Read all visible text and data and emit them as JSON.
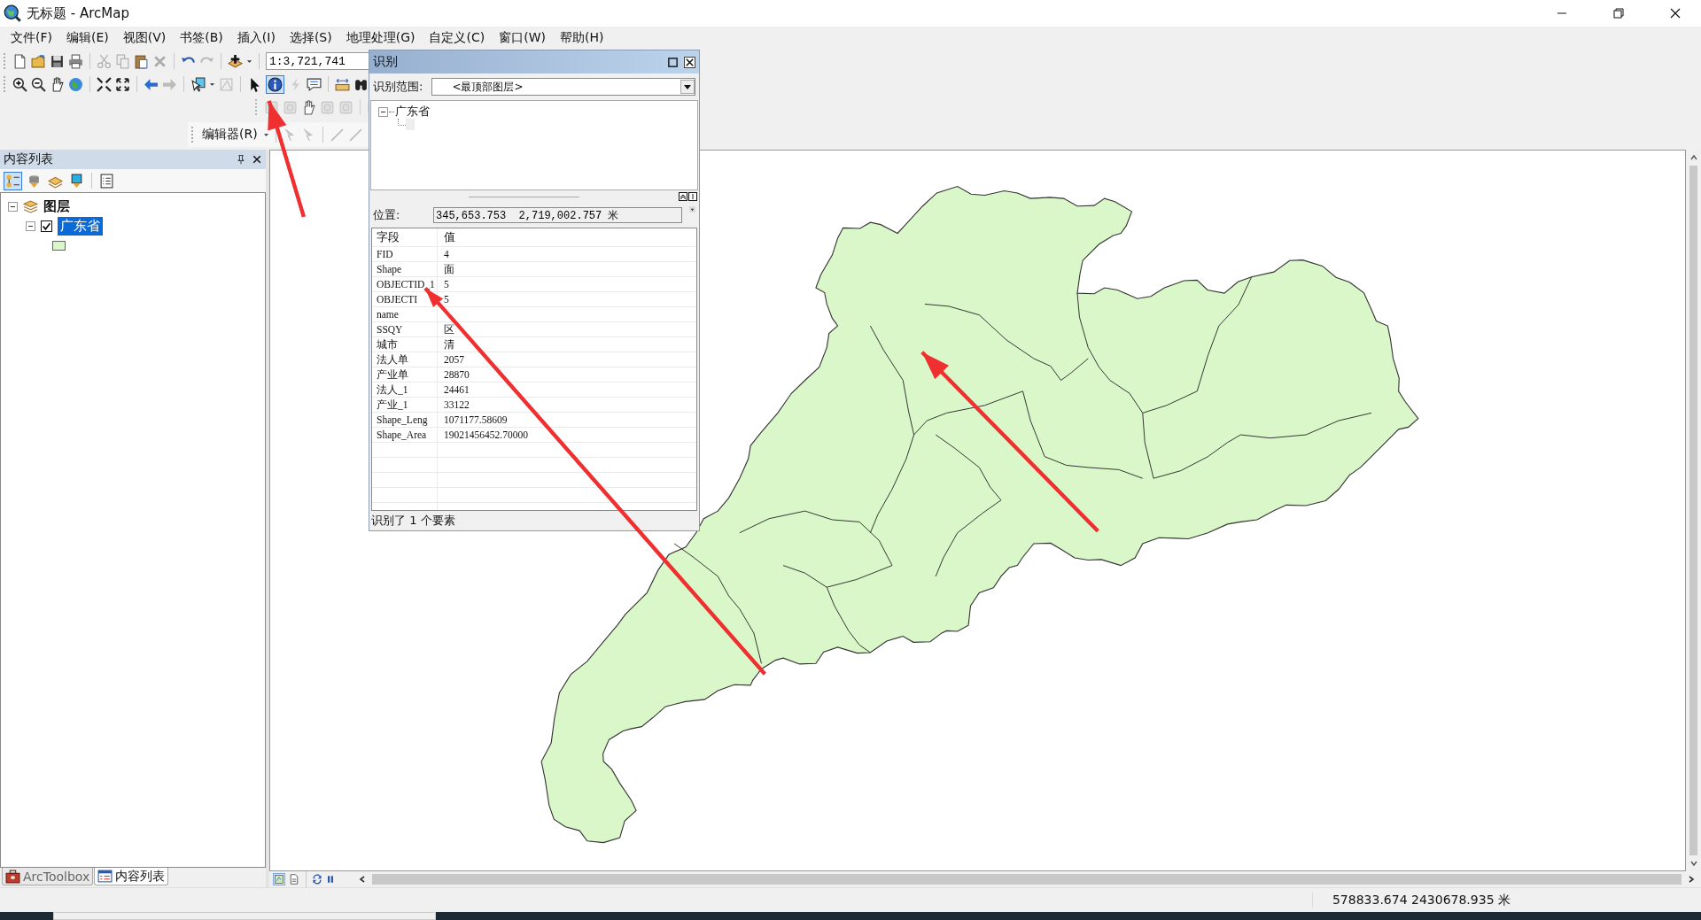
{
  "window": {
    "title": "无标题 - ArcMap"
  },
  "menu": [
    "文件(F)",
    "编辑(E)",
    "视图(V)",
    "书签(B)",
    "插入(I)",
    "选择(S)",
    "地理处理(G)",
    "自定义(C)",
    "窗口(W)",
    "帮助(H)"
  ],
  "scale_field": {
    "value": "1:3,721,741"
  },
  "identify_tool": {
    "selected": true
  },
  "editor_menu": {
    "label": "编辑器(R)"
  },
  "toc": {
    "title": "内容列表",
    "view_buttons": [
      {
        "selected": true
      },
      {
        "selected": false
      },
      {
        "selected": false
      },
      {
        "selected": false
      },
      {
        "selected": false
      }
    ],
    "tree": [
      {
        "label": "图层",
        "expanded": true,
        "children": [
          {
            "label": "广东省",
            "expanded": true,
            "checked": true,
            "selected": true
          }
        ]
      }
    ],
    "tabs": [
      {
        "label": "ArcToolbox",
        "selected": false
      },
      {
        "label": "内容列表",
        "selected": true
      }
    ]
  },
  "map_view_buttons": [
    {
      "selected": true
    },
    {
      "selected": false
    }
  ],
  "identify_window": {
    "title": "识别",
    "scope_label": "识别范围:",
    "scope_value": "<最顶部图层>",
    "tree": [
      {
        "label": "广东省",
        "expanded": true
      }
    ],
    "location_label": "位置:",
    "location_value": "345,653.753  2,719,002.757 米",
    "columns": [
      "字段",
      "值"
    ],
    "rows": [
      {
        "field": "FID",
        "value": "4"
      },
      {
        "field": "Shape",
        "value": "面"
      },
      {
        "field": "OBJECTID_1",
        "value": "5"
      },
      {
        "field": "OBJECTI",
        "value": "5"
      },
      {
        "field": "name"
      },
      {
        "field": "SSQY",
        "value": "区"
      },
      {
        "field": "城市",
        "value": "清"
      },
      {
        "field": "法人单",
        "value": "2057"
      },
      {
        "field": "产业单",
        "value": "28870"
      },
      {
        "field": "法人_1",
        "value": "24461"
      },
      {
        "field": "产业_1",
        "value": "33122"
      },
      {
        "field": "Shape_Leng",
        "value": "1071177.58609"
      },
      {
        "field": "Shape_Area",
        "value": "19021456452.70000"
      }
    ],
    "status": "识别了 1 个要素"
  },
  "status_bar": {
    "coordinates": "578833.674  2430678.935 米"
  }
}
